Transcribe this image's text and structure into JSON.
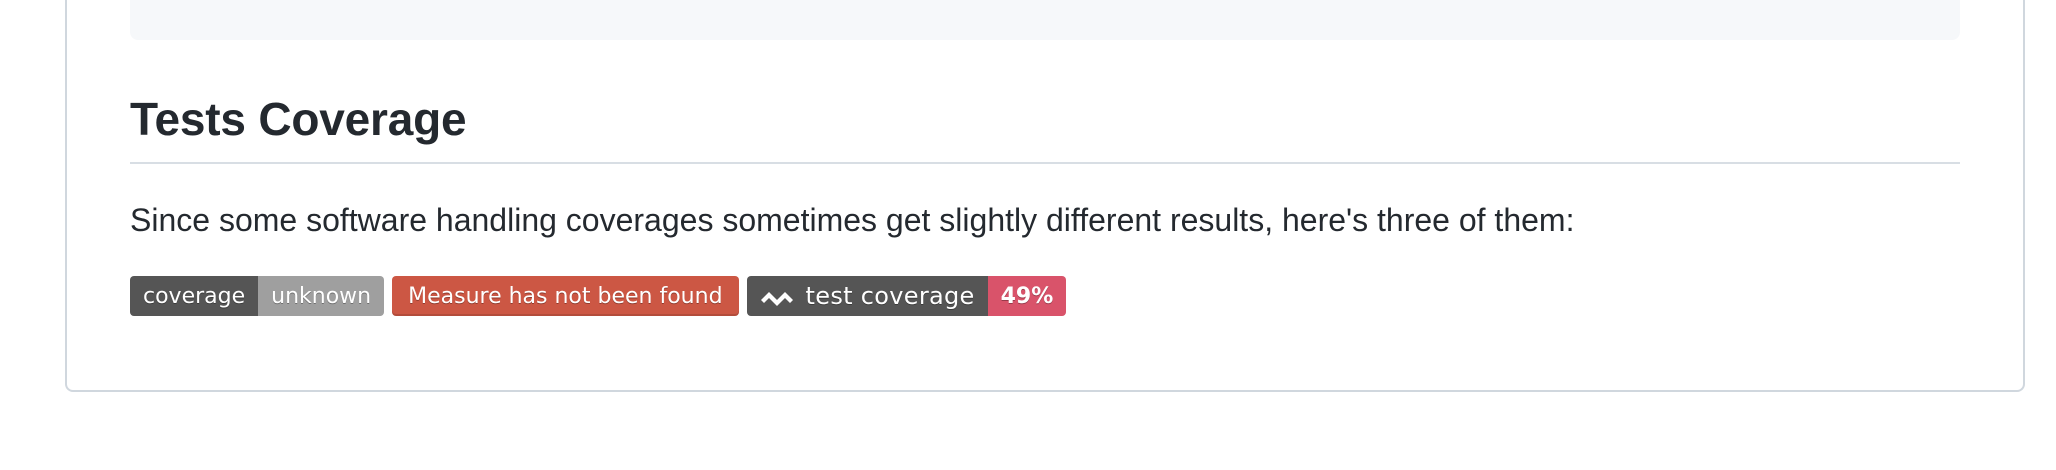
{
  "section": {
    "heading": "Tests Coverage",
    "paragraph": "Since some software handling coverages sometimes get slightly different results, here's three of them:"
  },
  "badges": [
    {
      "kind": "coverage-status",
      "label": "coverage",
      "value": "unknown",
      "label_color": "#555555",
      "value_color": "#9f9f9f"
    },
    {
      "kind": "measure-error",
      "text": "Measure has not been found",
      "color": "#cc5744"
    },
    {
      "kind": "code-climate",
      "icon": "code-climate-icon",
      "label": "test coverage",
      "value": "49%",
      "label_color": "#555555",
      "value_color": "#d9536a"
    }
  ],
  "colors": {
    "text": "#24292f",
    "border": "#d0d7de",
    "code_background": "#f6f8fa"
  }
}
